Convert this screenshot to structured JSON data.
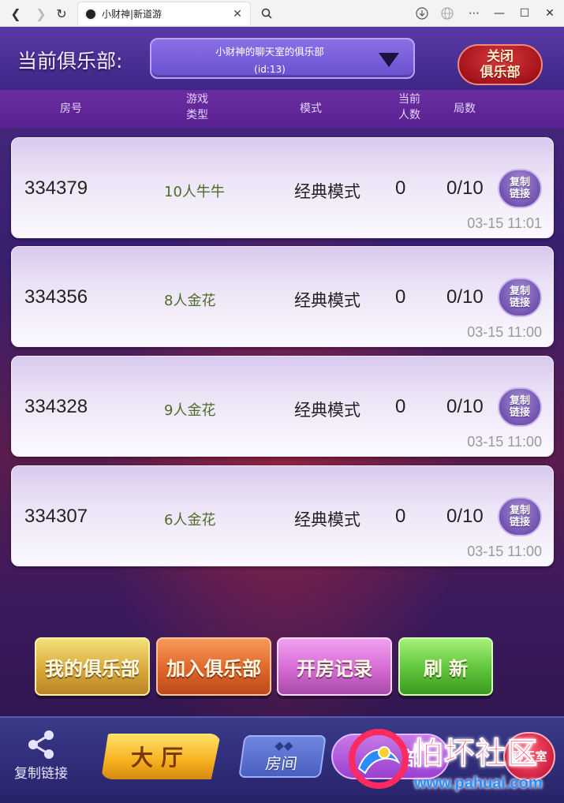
{
  "browser": {
    "tab_title": "小财神|新道游"
  },
  "header": {
    "club_label": "当前俱乐部:",
    "club_name": "小财神的聊天室的俱乐部",
    "club_id": "(id:13)",
    "close_club": "关闭\n俱乐部"
  },
  "columns": {
    "room_no": "房号",
    "game_type": "游戏\n类型",
    "mode": "模式",
    "players": "当前\n人数",
    "rounds": "局数"
  },
  "rooms": [
    {
      "room_no": "334379",
      "game_type": "10人牛牛",
      "mode": "经典模式",
      "players": "0",
      "rounds": "0/10",
      "copy": "复制\n链接",
      "time": "03-15 11:01"
    },
    {
      "room_no": "334356",
      "game_type": "8人金花",
      "mode": "经典模式",
      "players": "0",
      "rounds": "0/10",
      "copy": "复制\n链接",
      "time": "03-15 11:00"
    },
    {
      "room_no": "334328",
      "game_type": "9人金花",
      "mode": "经典模式",
      "players": "0",
      "rounds": "0/10",
      "copy": "复制\n链接",
      "time": "03-15 11:00"
    },
    {
      "room_no": "334307",
      "game_type": "6人金花",
      "mode": "经典模式",
      "players": "0",
      "rounds": "0/10",
      "copy": "复制\n链接",
      "time": "03-15 11:00"
    }
  ],
  "actions": {
    "my_club": "我的俱乐部",
    "join_club": "加入俱乐部",
    "room_records": "开房记录",
    "refresh": "刷 新"
  },
  "bottom_nav": {
    "share_label": "复制链接",
    "hall": "大厅",
    "room": "房间",
    "club": "部",
    "chat": "聊天室"
  },
  "watermark": {
    "text": "怕坏社区",
    "url": "www.pahuai.com"
  }
}
